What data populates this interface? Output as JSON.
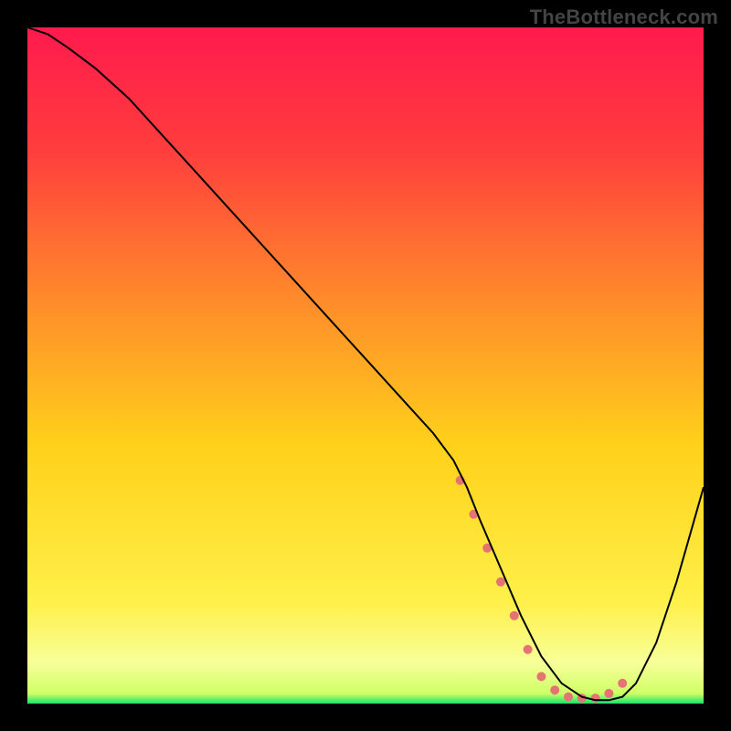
{
  "watermark": "TheBottleneck.com",
  "chart_data": {
    "type": "line",
    "title": "",
    "xlabel": "",
    "ylabel": "",
    "xlim": [
      0,
      100
    ],
    "ylim": [
      0,
      100
    ],
    "grid": false,
    "legend": false,
    "background_gradient": {
      "top_color": "#ff1a4d",
      "mid_color": "#ffd91a",
      "bottom_band_color": "#f7ff99",
      "floor_color": "#19e36b"
    },
    "series": [
      {
        "name": "curve",
        "stroke": "#000000",
        "stroke_width": 2,
        "x": [
          0,
          3,
          6,
          10,
          15,
          20,
          25,
          30,
          35,
          40,
          45,
          50,
          55,
          60,
          63,
          65,
          67,
          70,
          73,
          76,
          79,
          82,
          84,
          86,
          88,
          90,
          93,
          96,
          100
        ],
        "values": [
          100,
          99,
          97,
          94,
          89.5,
          84,
          78.5,
          73,
          67.5,
          62,
          56.5,
          51,
          45.5,
          40,
          36,
          32,
          27,
          20,
          13,
          7,
          3,
          1,
          0.5,
          0.5,
          1,
          3,
          9,
          18,
          32
        ]
      },
      {
        "name": "valley-dots",
        "type": "scatter",
        "stroke": "#e57373",
        "fill": "#e57373",
        "marker_radius": 5,
        "x": [
          64,
          66,
          68,
          70,
          72,
          74,
          76,
          78,
          80,
          82,
          84,
          86,
          88
        ],
        "values": [
          33,
          28,
          23,
          18,
          13,
          8,
          4,
          2,
          1,
          0.8,
          0.8,
          1.5,
          3
        ]
      }
    ]
  }
}
